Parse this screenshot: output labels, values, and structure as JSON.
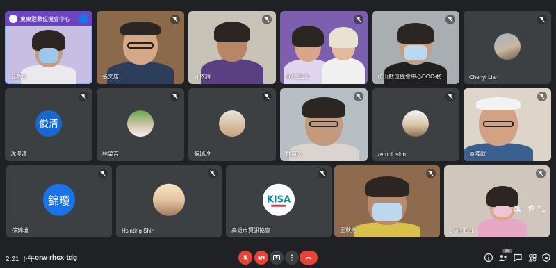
{
  "meeting": {
    "time": "2:21 下午",
    "separator": "|",
    "code": "orw-rhcx-tdg",
    "participant_count": "18"
  },
  "participants": [
    {
      "name": "芸數位",
      "banner": "東東港數位機會中心"
    },
    {
      "name": "張文店"
    },
    {
      "name": "許依詩"
    },
    {
      "name": "06I溫玉燕"
    },
    {
      "name": "枋山數位機會中心DOC-枋..."
    },
    {
      "name": "Chenyi Lian"
    },
    {
      "name": "沈俊清",
      "initials": "俊清"
    },
    {
      "name": "林榮吉"
    },
    {
      "name": "張瑞玲"
    },
    {
      "name": "戴盛文"
    },
    {
      "name": "zeroplusinn"
    },
    {
      "name": "黃隆獻"
    },
    {
      "name": "徐錦瓊",
      "initials": "錦瓊"
    },
    {
      "name": "Hsinting Shih"
    },
    {
      "name": "高雄市資訊協會",
      "logo_text": "KISA"
    },
    {
      "name": "王秋燕"
    },
    {
      "name": "Lynn Tsai",
      "self_label": "你"
    }
  ],
  "colors": {
    "background": "#202124",
    "tile": "#3c4043",
    "active_outline": "#8ab4f8",
    "avatar_blue": "#1967d2",
    "hangup_red": "#ea4335",
    "banner_purple": "#6b46c1"
  },
  "icons": {
    "mic_off": "mic-off-icon",
    "camera_off": "camera-off-icon",
    "present": "present-icon",
    "more": "more-vert-icon",
    "hang_up": "call-end-icon",
    "info": "info-icon",
    "people": "people-icon",
    "chat": "chat-icon",
    "activities": "activities-icon",
    "host_controls": "lock-icon"
  }
}
